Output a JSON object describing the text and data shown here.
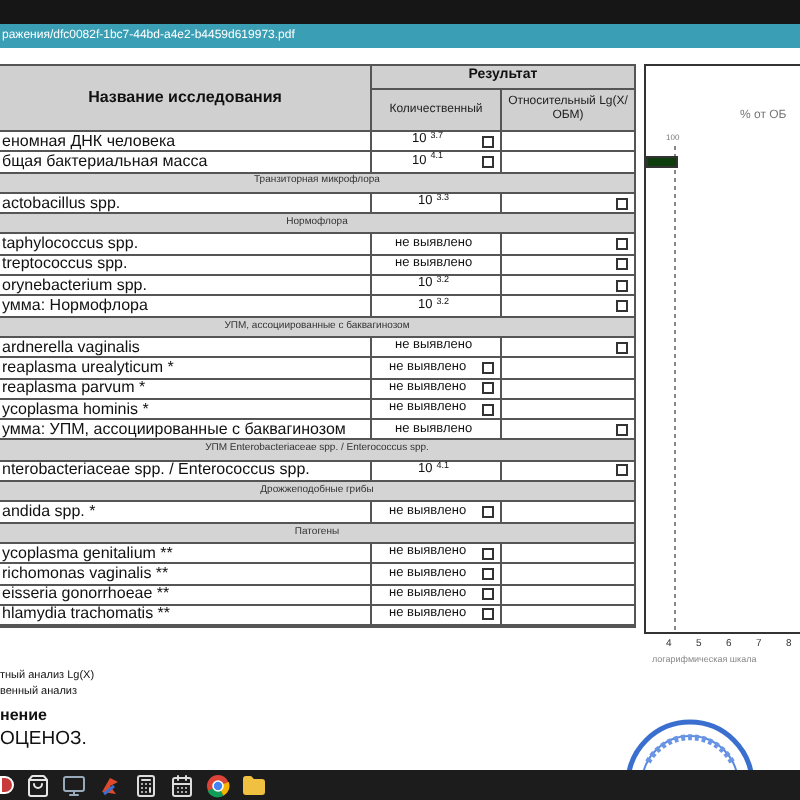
{
  "window": {
    "title": "ражения/dfc0082f-1bc7-44bd-a4e2-b4459d619973.pdf"
  },
  "table": {
    "columns": {
      "name": "Название исследования",
      "result": "Результат",
      "quantitative": "Количественный",
      "relative": "Относительный Lg(X/ОБМ)"
    },
    "rows": [
      {
        "kind": "quant_box",
        "name": "еномная ДНК человека",
        "value": "10",
        "exponent": "3.7",
        "checked": false
      },
      {
        "kind": "quant_box",
        "name": "бщая бактериальная масса",
        "value": "10",
        "exponent": "4.1",
        "checked": false
      },
      {
        "kind": "section",
        "name": "Транзиторная микрофлора"
      },
      {
        "kind": "rel_box",
        "name": "actobacillus spp.",
        "value": "10",
        "exponent": "3.3",
        "checked": false
      },
      {
        "kind": "section",
        "name": "Нормофлора"
      },
      {
        "kind": "rel_box",
        "name": "taphylococcus spp.",
        "value": "не выявлено",
        "checked": false
      },
      {
        "kind": "rel_box",
        "name": "treptococcus spp.",
        "value": "не выявлено",
        "checked": false
      },
      {
        "kind": "rel_box",
        "name": "orynebacterium spp.",
        "value": "10",
        "exponent": "3.2",
        "checked": false
      },
      {
        "kind": "rel_box",
        "name": "умма: Нормофлора",
        "value": "10",
        "exponent": "3.2",
        "checked": false
      },
      {
        "kind": "section",
        "name": "УПМ, ассоциированные с баквагинозом"
      },
      {
        "kind": "rel_box",
        "name": "ardnerella vaginalis",
        "value": "не выявлено",
        "checked": false
      },
      {
        "kind": "quant_box",
        "name": "reaplasma urealyticum *",
        "value": "не выявлено",
        "checked": false
      },
      {
        "kind": "quant_box",
        "name": "reaplasma parvum *",
        "value": "не выявлено",
        "checked": false
      },
      {
        "kind": "quant_box",
        "name": "ycoplasma hominis *",
        "value": "не выявлено",
        "checked": false
      },
      {
        "kind": "rel_box",
        "name": "умма: УПМ, ассоциированные с баквагинозом",
        "value": "не выявлено",
        "checked": false
      },
      {
        "kind": "section",
        "name": "УПМ Enterobacteriaceae spp. / Enterococcus spp."
      },
      {
        "kind": "rel_box",
        "name": "nterobacteriaceae spp. / Enterococcus spp.",
        "value": "10",
        "exponent": "4.1",
        "checked": false
      },
      {
        "kind": "section",
        "name": "Дрожжеподобные грибы"
      },
      {
        "kind": "quant_box",
        "name": "andida spp. *",
        "value": "не выявлено",
        "checked": false
      },
      {
        "kind": "section",
        "name": "Патогены"
      },
      {
        "kind": "quant_box",
        "name": "ycoplasma genitalium **",
        "value": "не выявлено",
        "checked": false
      },
      {
        "kind": "quant_box",
        "name": "richomonas vaginalis **",
        "value": "не выявлено",
        "checked": false
      },
      {
        "kind": "quant_box",
        "name": "eisseria gonorrhoeae **",
        "value": "не выявлено",
        "checked": false
      },
      {
        "kind": "quant_box",
        "name": "hlamydia trachomatis **",
        "value": "не выявлено",
        "checked": false
      }
    ]
  },
  "chart": {
    "title": "% от ОБ",
    "top_tick": "100",
    "x_ticks": [
      "4",
      "5",
      "6",
      "7",
      "8"
    ],
    "xlabel": "логарифмическая шкала"
  },
  "footnotes": [
    "тный анализ Lg(X)",
    "венный анализ"
  ],
  "conclusion": {
    "heading": "нение",
    "text": "ОЦЕНОЗ."
  }
}
